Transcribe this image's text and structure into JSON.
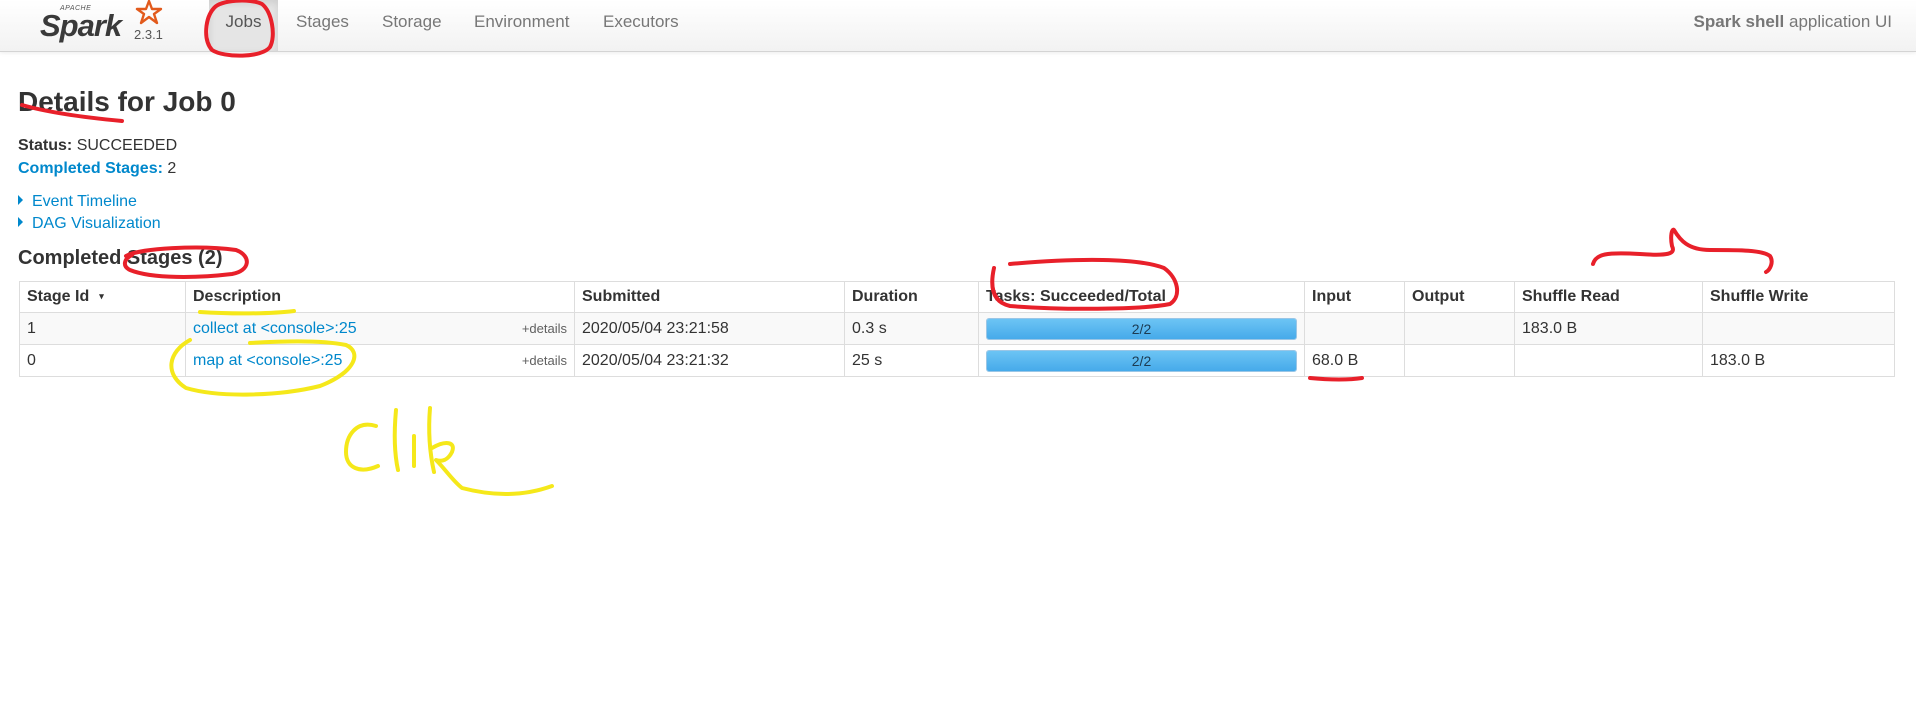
{
  "navbar": {
    "brand_apache": "APACHE",
    "brand_name": "Spark",
    "version": "2.3.1",
    "tabs": [
      {
        "label": "Jobs",
        "active": true
      },
      {
        "label": "Stages",
        "active": false
      },
      {
        "label": "Storage",
        "active": false
      },
      {
        "label": "Environment",
        "active": false
      },
      {
        "label": "Executors",
        "active": false
      }
    ],
    "app_name": "Spark shell",
    "app_suffix": " application UI"
  },
  "page": {
    "title": "Details for Job 0",
    "status_label": "Status:",
    "status_value": "SUCCEEDED",
    "completed_stages_label": "Completed Stages:",
    "completed_stages_value": "2",
    "event_timeline": "Event Timeline",
    "dag_visualization": "DAG Visualization",
    "section_title": "Completed Stages (2)"
  },
  "table": {
    "headers": {
      "stage_id": "Stage Id",
      "sort_indicator": "▾",
      "description": "Description",
      "submitted": "Submitted",
      "duration": "Duration",
      "tasks": "Tasks: Succeeded/Total",
      "input": "Input",
      "output": "Output",
      "shuffle_read": "Shuffle Read",
      "shuffle_write": "Shuffle Write"
    },
    "rows": [
      {
        "stage_id": "1",
        "description": "collect at <console>:25",
        "details": "+details",
        "submitted": "2020/05/04 23:21:58",
        "duration": "0.3 s",
        "tasks": "2/2",
        "tasks_fraction": 1.0,
        "input": "",
        "output": "",
        "shuffle_read": "183.0 B",
        "shuffle_write": ""
      },
      {
        "stage_id": "0",
        "description": "map at <console>:25",
        "details": "+details",
        "submitted": "2020/05/04 23:21:32",
        "duration": "25 s",
        "tasks": "2/2",
        "tasks_fraction": 1.0,
        "input": "68.0 B",
        "output": "",
        "shuffle_read": "",
        "shuffle_write": "183.0 B"
      }
    ]
  },
  "annotations": {
    "red_color": "#e8202a",
    "yellow_color": "#f5e81a",
    "handwritten_text": "Click"
  }
}
